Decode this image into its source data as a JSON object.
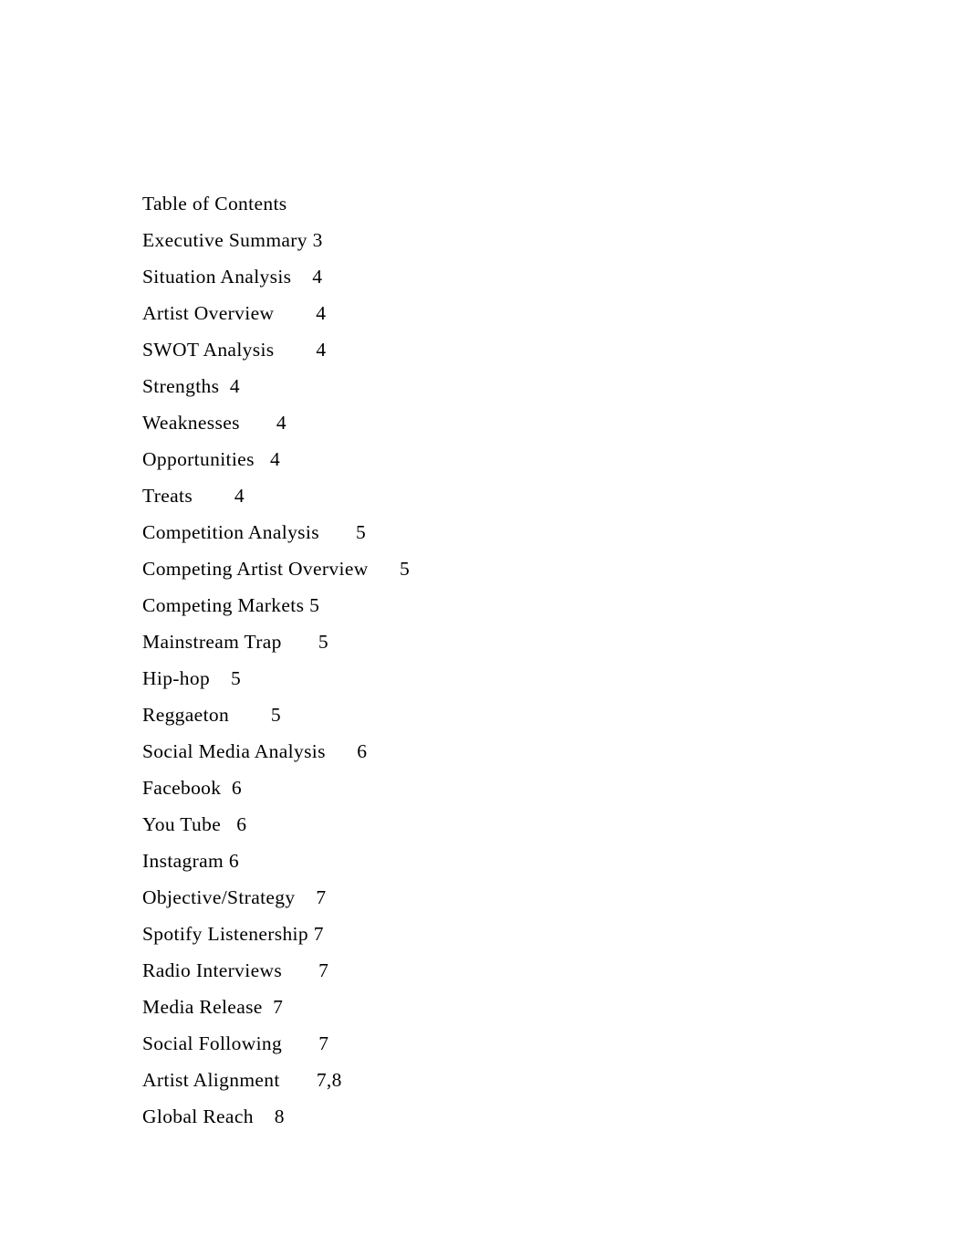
{
  "document": {
    "page_background": "#ffffff",
    "text_color": "#000000",
    "heading": "Table of Contents",
    "entries": [
      {
        "title": "Executive Summary",
        "gap": " ",
        "page": "3"
      },
      {
        "title": "Situation Analysis",
        "gap": "    ",
        "page": "4"
      },
      {
        "title": "Artist Overview",
        "gap": "        ",
        "page": "4"
      },
      {
        "title": "SWOT Analysis",
        "gap": "        ",
        "page": "4"
      },
      {
        "title": "Strengths",
        "gap": "  ",
        "page": "4"
      },
      {
        "title": "Weaknesses",
        "gap": "       ",
        "page": "4"
      },
      {
        "title": "Opportunities",
        "gap": "   ",
        "page": "4"
      },
      {
        "title": "Treats",
        "gap": "        ",
        "page": "4"
      },
      {
        "title": "Competition Analysis",
        "gap": "       ",
        "page": "5"
      },
      {
        "title": "Competing Artist Overview",
        "gap": "      ",
        "page": "5"
      },
      {
        "title": "Competing Markets",
        "gap": " ",
        "page": "5"
      },
      {
        "title": "Mainstream Trap",
        "gap": "       ",
        "page": "5"
      },
      {
        "title": "Hip-hop",
        "gap": "    ",
        "page": "5"
      },
      {
        "title": "Reggaeton",
        "gap": "        ",
        "page": "5"
      },
      {
        "title": "Social Media Analysis",
        "gap": "      ",
        "page": "6"
      },
      {
        "title": "Facebook",
        "gap": "  ",
        "page": "6"
      },
      {
        "title": "You Tube",
        "gap": "   ",
        "page": "6"
      },
      {
        "title": "Instagram",
        "gap": " ",
        "page": "6"
      },
      {
        "title": "Objective/Strategy",
        "gap": "    ",
        "page": "7"
      },
      {
        "title": "Spotify Listenership",
        "gap": " ",
        "page": "7"
      },
      {
        "title": "Radio Interviews",
        "gap": "       ",
        "page": "7"
      },
      {
        "title": "Media Release",
        "gap": "  ",
        "page": "7"
      },
      {
        "title": "Social Following",
        "gap": "       ",
        "page": "7"
      },
      {
        "title": "Artist Alignment",
        "gap": "       ",
        "page": "7,8"
      },
      {
        "title": "Global Reach",
        "gap": "    ",
        "page": "8"
      }
    ]
  }
}
